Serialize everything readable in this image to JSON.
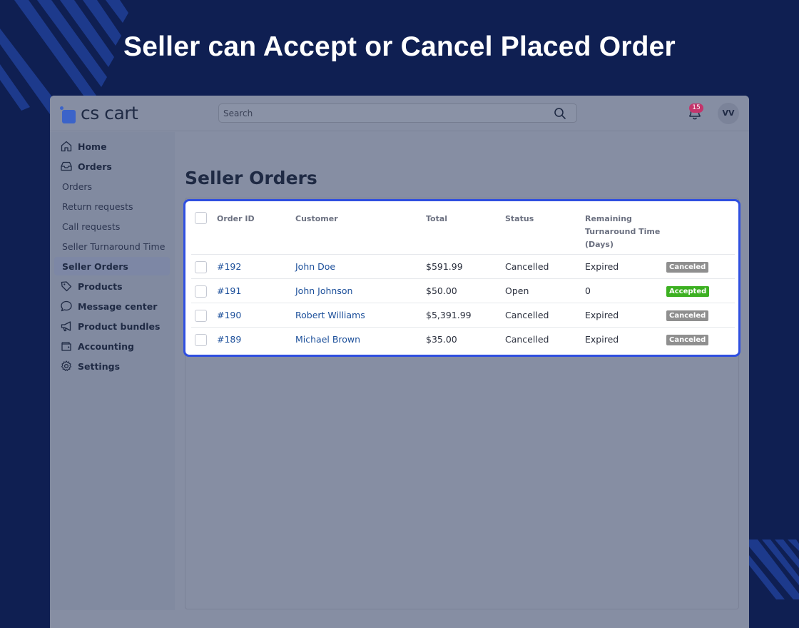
{
  "headline": "Seller can Accept or Cancel Placed Order",
  "brand": {
    "name": "cs cart",
    "color": "#3b63c9"
  },
  "search": {
    "placeholder": "Search",
    "icon": "search-icon"
  },
  "notifications": {
    "count": "15",
    "icon": "bell-icon"
  },
  "user": {
    "initials": "VV"
  },
  "sidebar": {
    "items": [
      {
        "label": "Home",
        "icon": "home-icon"
      },
      {
        "label": "Orders",
        "icon": "inbox-icon"
      },
      {
        "label": "Orders",
        "sub": true
      },
      {
        "label": "Return requests",
        "sub": true
      },
      {
        "label": "Call requests",
        "sub": true
      },
      {
        "label": "Seller Turnaround Time",
        "sub": true
      },
      {
        "label": "Seller Orders",
        "sub": true,
        "active": true
      },
      {
        "label": "Products",
        "icon": "tag-icon"
      },
      {
        "label": "Message center",
        "icon": "chat-icon"
      },
      {
        "label": "Product bundles",
        "icon": "megaphone-icon"
      },
      {
        "label": "Accounting",
        "icon": "wallet-icon"
      },
      {
        "label": "Settings",
        "icon": "gear-icon"
      }
    ]
  },
  "page": {
    "title": "Seller Orders"
  },
  "orders": {
    "columns": {
      "order_id": "Order ID",
      "customer": "Customer",
      "total": "Total",
      "status": "Status",
      "remaining_l1": "Remaining",
      "remaining_l2": "Turnaround Time",
      "remaining_l3": "(Days)"
    },
    "rows": [
      {
        "id": "#192",
        "customer": "John Doe",
        "total": "$591.99",
        "status": "Cancelled",
        "remaining": "Expired",
        "badge": "Canceled"
      },
      {
        "id": "#191",
        "customer": "John Johnson",
        "total": "$50.00",
        "status": "Open",
        "remaining": "0",
        "badge": "Accepted"
      },
      {
        "id": "#190",
        "customer": "Robert Williams",
        "total": "$5,391.99",
        "status": "Cancelled",
        "remaining": "Expired",
        "badge": "Canceled"
      },
      {
        "id": "#189",
        "customer": "Michael Brown",
        "total": "$35.00",
        "status": "Cancelled",
        "remaining": "Expired",
        "badge": "Canceled"
      }
    ]
  },
  "colors": {
    "background": "#0f1f52",
    "highlight_border": "#2f4fe0",
    "badge_canceled": "#8f8f8f",
    "badge_accepted": "#3cb021",
    "notification_badge": "#c4346b"
  }
}
